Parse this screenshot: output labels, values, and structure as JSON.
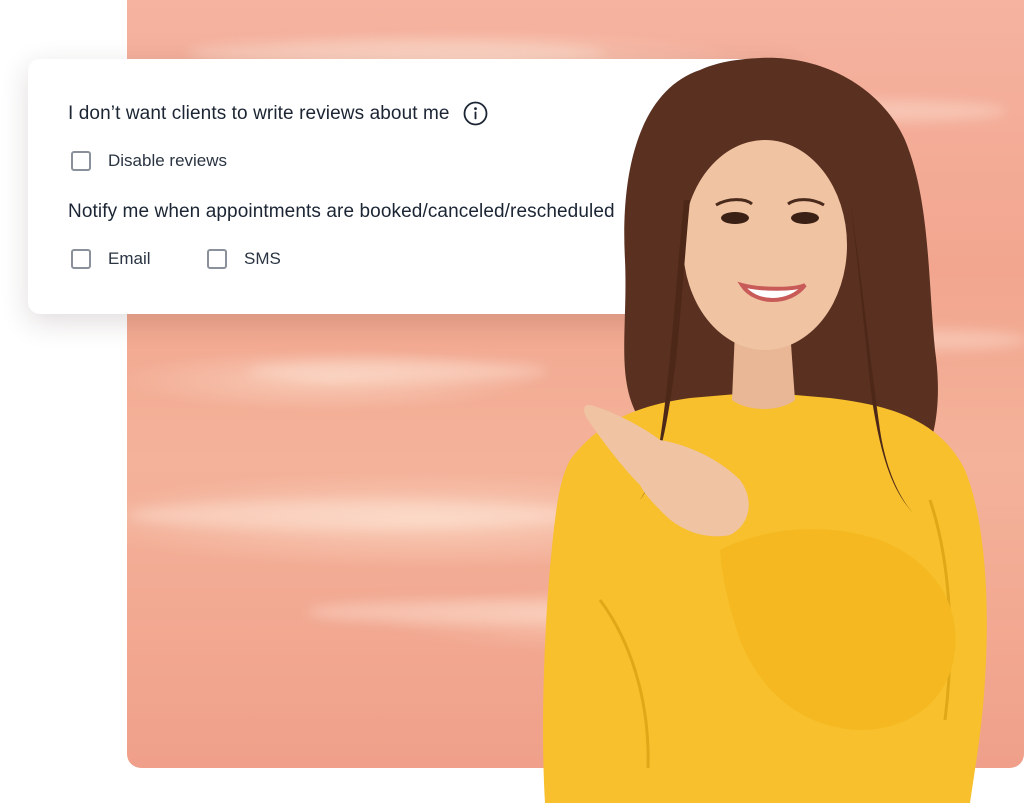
{
  "settings": {
    "reviews_heading": "I don’t want clients to write reviews about me",
    "reviews_info_icon": "info-icon",
    "disable_reviews_label": "Disable reviews",
    "disable_reviews_checked": false,
    "notify_heading": "Notify me when appointments are booked/canceled/rescheduled",
    "email_label": "Email",
    "email_checked": false,
    "sms_label": "SMS",
    "sms_checked": false
  },
  "colors": {
    "backdrop": "#f2a68f",
    "sweater": "#f7c02c",
    "text": "#1b2533",
    "checkbox_border": "#8a919b"
  }
}
